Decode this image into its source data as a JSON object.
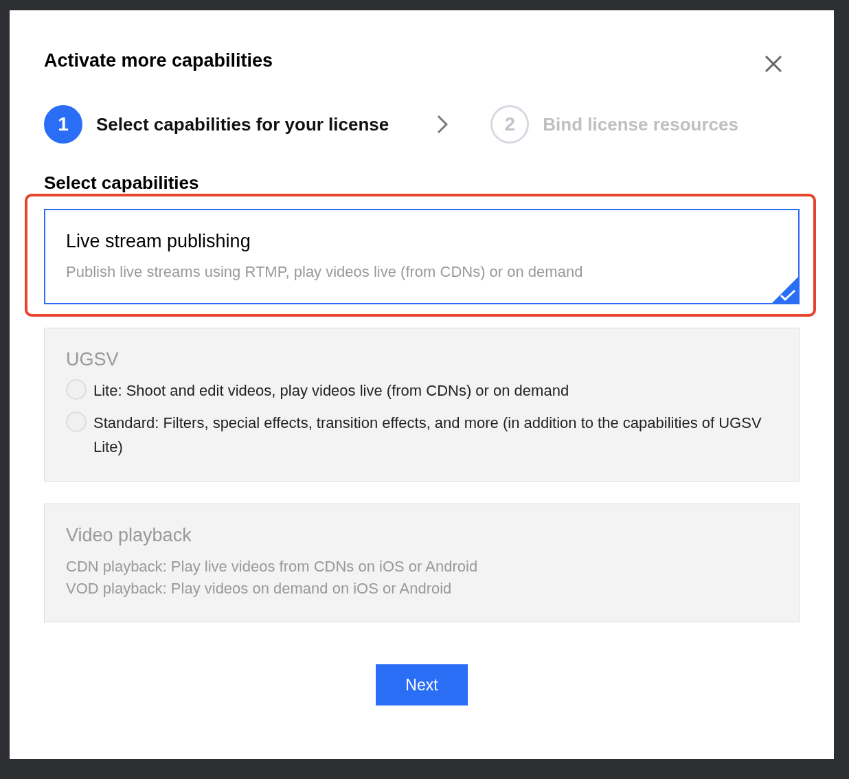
{
  "dialog": {
    "title": "Activate more capabilities"
  },
  "steps": [
    {
      "number": "1",
      "label": "Select capabilities for your license",
      "selected": true
    },
    {
      "number": "2",
      "label": "Bind license resources",
      "selected": false
    }
  ],
  "section_title": "Select capabilities",
  "capabilities": [
    {
      "kind": "simple",
      "title": "Live stream publishing",
      "description": "Publish live streams using RTMP, play videos live (from CDNs) or on demand",
      "selected": true,
      "disabled": false,
      "highlighted": true
    },
    {
      "kind": "options",
      "title": "UGSV",
      "selected": false,
      "disabled": true,
      "highlighted": false,
      "options": [
        {
          "label": "Lite: Shoot and edit videos, play videos live (from CDNs) or on demand",
          "selected": false
        },
        {
          "label": "Standard: Filters, special effects, transition effects, and more (in addition to the capabilities of UGSV Lite)",
          "selected": false
        }
      ]
    },
    {
      "kind": "lines",
      "title": "Video playback",
      "selected": false,
      "disabled": true,
      "highlighted": false,
      "lines": [
        "CDN playback: Play live videos from CDNs on iOS or Android",
        "VOD playback: Play videos on demand on iOS or Android"
      ]
    }
  ],
  "next_button": "Next"
}
